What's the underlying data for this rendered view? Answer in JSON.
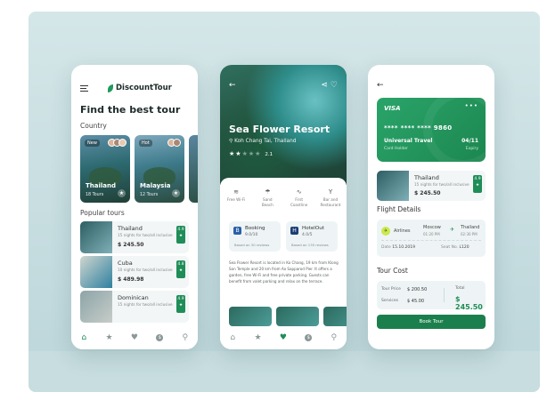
{
  "phone1": {
    "logo_text": "DiscountTour",
    "title": "Find the best tour",
    "section_country": "Country",
    "countries": [
      {
        "tag": "New",
        "name": "Thailand",
        "tours": "18 Tours"
      },
      {
        "tag": "Hot",
        "name": "Malaysia",
        "tours": "12 Tours"
      }
    ],
    "section_popular": "Popular tours",
    "tours": [
      {
        "name": "Thailand",
        "desc": "15 nights for two/all inclusive",
        "price": "$ 245.50",
        "rating": "4.9"
      },
      {
        "name": "Cuba",
        "desc": "10 nights for two/all inclusive",
        "price": "$ 489.98",
        "rating": "4.8"
      },
      {
        "name": "Dominican",
        "desc": "15 nights for two/all inclusive",
        "price": "",
        "rating": "4.9"
      }
    ]
  },
  "phone2": {
    "title": "Sea Flower Resort",
    "location": "Koh Chang Tai, Thailand",
    "rating_count": "2.1",
    "amenities": [
      {
        "label": "Free Wi-Fi"
      },
      {
        "label": "Sand Beach"
      },
      {
        "label": "First Coastline"
      },
      {
        "label": "Bar and Restaurant"
      }
    ],
    "booking": {
      "name": "Booking",
      "score": "9.0/10",
      "reviews": "Based on 30 reviews",
      "logo": "B"
    },
    "hotelout": {
      "name": "HotelOut",
      "score": "4.0/5",
      "reviews": "Based on 135 reviews",
      "logo": "H"
    },
    "description": "Sea Flower Resort is located in Ko Chang, 19 km from Klong Son Temple and 20 km from Ao Sapparod Pier. It offers a garden, free Wi-Fi and free private parking. Guests can benefit from valet parking and relax on the terrace."
  },
  "phone3": {
    "card": {
      "brand": "VISA",
      "number": "**** **** **** 9860",
      "holder": "Universal Travel",
      "holder_label": "Card Holder",
      "expiry": "04/11",
      "expiry_label": "Expiry"
    },
    "tour": {
      "name": "Thailand",
      "desc": "15 nights for two/all inclusive",
      "price": "$ 245.50",
      "rating": "4.9"
    },
    "flight_title": "Flight Details",
    "flight": {
      "airline": "Airlines",
      "from": "Moscow",
      "from_time": "01:20 PM",
      "to": "Thailand",
      "to_time": "02:30 PM",
      "date_label": "Date",
      "date": "15.10.2019",
      "seat_label": "Seat No.",
      "seat": "L120"
    },
    "cost_title": "Tour Cost",
    "cost": {
      "tour_price_label": "Tour Price",
      "tour_price": "$ 200.50",
      "services_label": "Services",
      "services": "$ 45.00",
      "total_label": "Total",
      "total": "$ 245.50"
    },
    "book_button": "Book Tour"
  },
  "colors": {
    "accent": "#1f8d58",
    "background": "#c9dfe1"
  }
}
